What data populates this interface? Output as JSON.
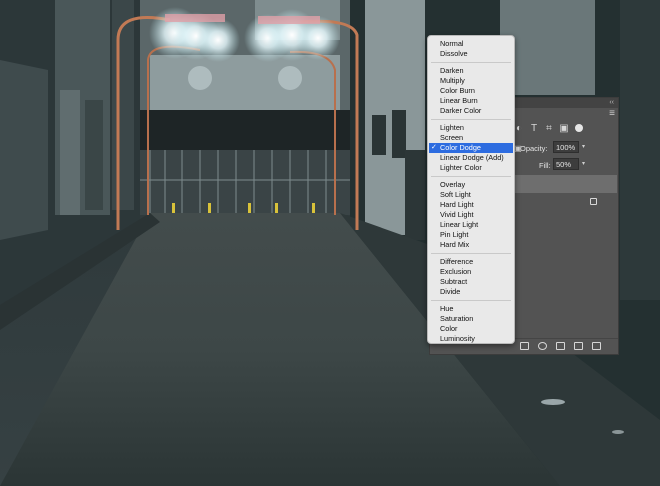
{
  "blend_menu": {
    "groups": [
      [
        "Normal",
        "Dissolve"
      ],
      [
        "Darken",
        "Multiply",
        "Color Burn",
        "Linear Burn",
        "Darker Color"
      ],
      [
        "Lighten",
        "Screen",
        "Color Dodge",
        "Linear Dodge (Add)",
        "Lighter Color"
      ],
      [
        "Overlay",
        "Soft Light",
        "Hard Light",
        "Vivid Light",
        "Linear Light",
        "Pin Light",
        "Hard Mix"
      ],
      [
        "Difference",
        "Exclusion",
        "Subtract",
        "Divide"
      ],
      [
        "Hue",
        "Saturation",
        "Color",
        "Luminosity"
      ]
    ],
    "selected": "Color Dodge",
    "check_glyph": "✓"
  },
  "layers_panel": {
    "collapse_glyph": "‹‹",
    "menu_glyph": "≡",
    "opacity_label": "Opacity:",
    "opacity_value": "100%",
    "fill_label": "Fill:",
    "fill_value": "50%",
    "caret_glyph": "▾",
    "background_layer_fragment": "d",
    "filter_icons": [
      "adjustment-filter-icon",
      "type-filter-icon",
      "shape-filter-icon",
      "smart-object-filter-icon"
    ],
    "filter_glyphs": [
      "◐",
      "T",
      "⌗",
      "▣"
    ],
    "bottom_icons": [
      "layer-mask-icon",
      "adjustment-layer-icon",
      "group-folder-icon",
      "new-layer-icon",
      "trash-icon"
    ]
  }
}
